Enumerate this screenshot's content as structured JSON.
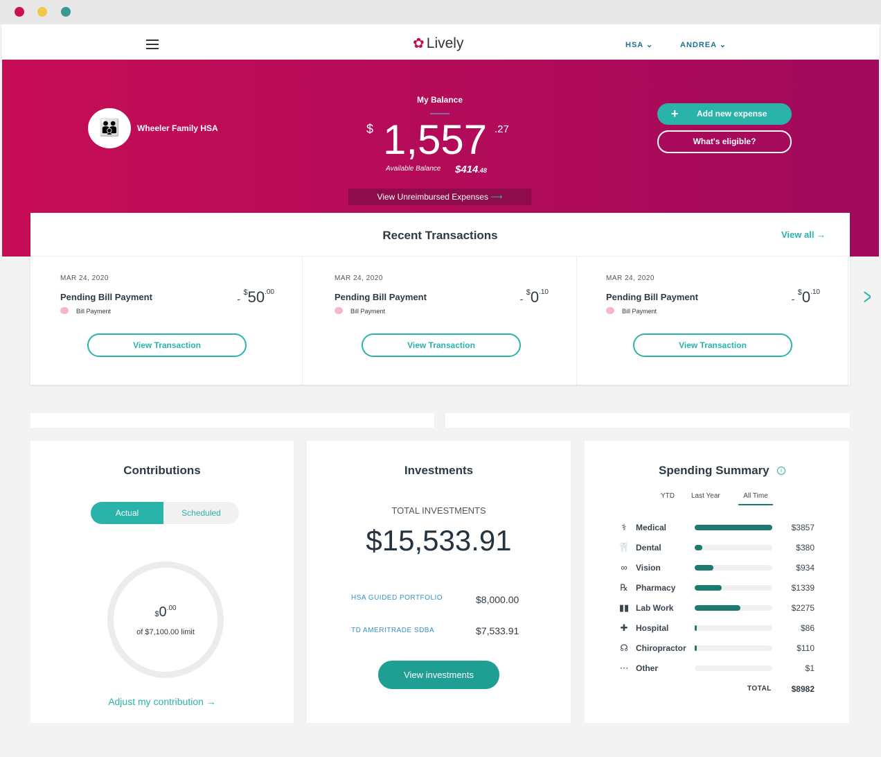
{
  "window": {
    "controls": [
      "close",
      "minimize",
      "maximize"
    ]
  },
  "nav": {
    "brand": "Lively",
    "account_menu": "HSA",
    "user_menu": "ANDREA"
  },
  "hero": {
    "account_name": "Wheeler Family HSA",
    "balance_label": "My Balance",
    "currency": "$",
    "balance_whole": "1,557",
    "balance_cents": ".27",
    "available_label": "Available Balance",
    "available_whole": "$414",
    "available_cents": ".48",
    "unreimbursed_link": "View Unreimbursed Expenses",
    "add_expense": "Add new expense",
    "whats_eligible": "What's eligible?"
  },
  "transactions": {
    "title": "Recent Transactions",
    "view_all": "View all →",
    "items": [
      {
        "date": "MAR 24, 2020",
        "title": "Pending Bill Payment",
        "type": "Bill Payment",
        "sign": "-",
        "currency": "$",
        "whole": "50",
        "cents": ".00",
        "button": "View Transaction"
      },
      {
        "date": "MAR 24, 2020",
        "title": "Pending Bill Payment",
        "type": "Bill Payment",
        "sign": "-",
        "currency": "$",
        "whole": "0",
        "cents": ".10",
        "button": "View Transaction"
      },
      {
        "date": "MAR 24, 2020",
        "title": "Pending Bill Payment",
        "type": "Bill Payment",
        "sign": "-",
        "currency": "$",
        "whole": "0",
        "cents": ".10",
        "button": "View Transaction"
      }
    ]
  },
  "contributions": {
    "title": "Contributions",
    "tabs": [
      "Actual",
      "Scheduled"
    ],
    "active_tab": "Actual",
    "currency": "$",
    "amount_whole": "0",
    "amount_cents": ".00",
    "limit": "of $7,100.00 limit",
    "progress": 0,
    "adjust_link": "Adjust my contribution →"
  },
  "investments": {
    "title": "Investments",
    "total_label": "TOTAL INVESTMENTS",
    "total": "$15,533.91",
    "rows": [
      {
        "name": "HSA GUIDED PORTFOLIO",
        "value": "$8,000.00"
      },
      {
        "name": "TD AMERITRADE SDBA",
        "value": "$7,533.91"
      }
    ],
    "button": "View investments"
  },
  "spending": {
    "title": "Spending Summary",
    "tabs": [
      "YTD",
      "Last Year",
      "All Time"
    ],
    "active_tab": "All Time",
    "categories": [
      {
        "icon": "stethoscope-icon",
        "glyph": "⚕",
        "name": "Medical",
        "amount": 3857,
        "label": "$3857"
      },
      {
        "icon": "tooth-icon",
        "glyph": "🦷",
        "name": "Dental",
        "amount": 380,
        "label": "$380"
      },
      {
        "icon": "glasses-icon",
        "glyph": "∞",
        "name": "Vision",
        "amount": 934,
        "label": "$934"
      },
      {
        "icon": "pill-bottle-icon",
        "glyph": "℞",
        "name": "Pharmacy",
        "amount": 1339,
        "label": "$1339"
      },
      {
        "icon": "test-tubes-icon",
        "glyph": "▮▮",
        "name": "Lab Work",
        "amount": 2275,
        "label": "$2275"
      },
      {
        "icon": "hospital-icon",
        "glyph": "✚",
        "name": "Hospital",
        "amount": 86,
        "label": "$86"
      },
      {
        "icon": "spine-icon",
        "glyph": "☊",
        "name": "Chiropractor",
        "amount": 110,
        "label": "$110"
      },
      {
        "icon": "more-icon",
        "glyph": "⋯",
        "name": "Other",
        "amount": 1,
        "label": "$1"
      }
    ],
    "total_label": "TOTAL",
    "total": "$8982"
  },
  "colors": {
    "brand_pink": "#c60c55",
    "teal": "#2ab3a8",
    "dark_teal": "#1e7a70"
  }
}
